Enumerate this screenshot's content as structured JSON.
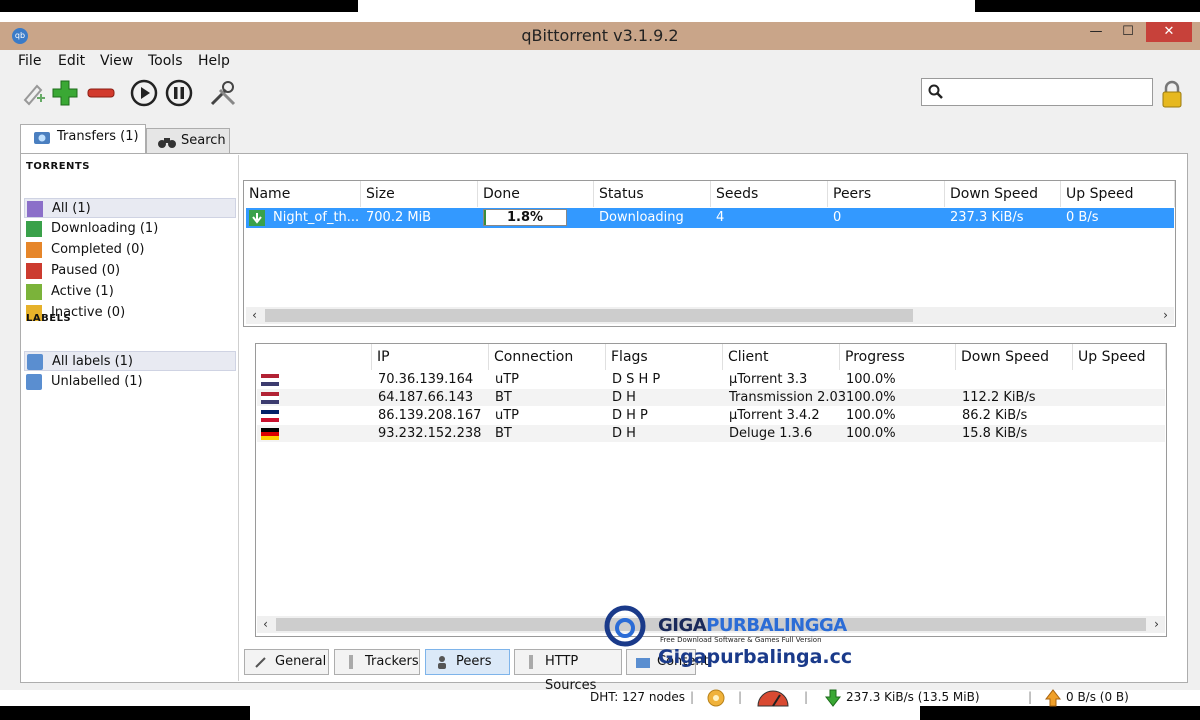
{
  "window": {
    "title": "qBittorrent v3.1.9.2"
  },
  "menu": [
    "File",
    "Edit",
    "View",
    "Tools",
    "Help"
  ],
  "toolbar": {
    "icons": [
      "add-link-icon",
      "add-torrent-icon",
      "delete-icon",
      "resume-icon",
      "pause-icon",
      "options-icon"
    ],
    "search_value": ""
  },
  "tabs": {
    "transfers": "Transfers (1)",
    "search": "Search"
  },
  "sidebar": {
    "torrents_title": "Torrents",
    "torrents": [
      {
        "label": "All (1)",
        "color": "#8b6fc9"
      },
      {
        "label": "Downloading (1)",
        "color": "#3aa14a"
      },
      {
        "label": "Completed (0)",
        "color": "#e6862a"
      },
      {
        "label": "Paused (0)",
        "color": "#cc3b2f"
      },
      {
        "label": "Active (1)",
        "color": "#7bb33a"
      },
      {
        "label": "Inactive (0)",
        "color": "#e6b12a"
      }
    ],
    "labels_title": "Labels",
    "labels": [
      {
        "label": "All labels (1)"
      },
      {
        "label": "Unlabelled (1)"
      }
    ]
  },
  "torrents_table": {
    "headers": [
      "Name",
      "Size",
      "Done",
      "Status",
      "Seeds",
      "Peers",
      "Down Speed",
      "Up Speed"
    ],
    "rows": [
      {
        "name": "Night_of_th...",
        "size": "700.2 MiB",
        "done": "1.8%",
        "progress": 0.018,
        "status": "Downloading",
        "seeds": "4",
        "peers": "0",
        "down": "237.3 KiB/s",
        "up": "0 B/s"
      }
    ]
  },
  "peers_table": {
    "headers": [
      "",
      "IP",
      "Connection",
      "Flags",
      "Client",
      "Progress",
      "Down Speed",
      "Up Speed"
    ],
    "rows": [
      {
        "flag": "us-flag-icon",
        "ip": "70.36.139.164",
        "conn": "uTP",
        "flags": "D S H P",
        "client": "µTorrent 3.3",
        "progress": "100.0%",
        "down": "",
        "up": ""
      },
      {
        "flag": "us-flag-icon",
        "ip": "64.187.66.143",
        "conn": "BT",
        "flags": "D H",
        "client": "Transmission 2.03",
        "progress": "100.0%",
        "down": "112.2 KiB/s",
        "up": ""
      },
      {
        "flag": "uk-flag-icon",
        "ip": "86.139.208.167",
        "conn": "uTP",
        "flags": "D H P",
        "client": "µTorrent 3.4.2",
        "progress": "100.0%",
        "down": "86.2 KiB/s",
        "up": ""
      },
      {
        "flag": "de-flag-icon",
        "ip": "93.232.152.238",
        "conn": "BT",
        "flags": "D H",
        "client": "Deluge 1.3.6",
        "progress": "100.0%",
        "down": "15.8 KiB/s",
        "up": ""
      }
    ]
  },
  "bottom_tabs": [
    "General",
    "Trackers",
    "Peers",
    "HTTP Sources",
    "Content"
  ],
  "status": {
    "dht": "DHT: 127 nodes",
    "down": "237.3 KiB/s (13.5 MiB)",
    "up": "0 B/s (0 B)"
  },
  "watermark": {
    "brand_a": "GIGA",
    "brand_b": "PURBALINGGA",
    "tagline": "Free Download Software & Games Full Version",
    "url": "Gigapurbalinga.cc"
  }
}
